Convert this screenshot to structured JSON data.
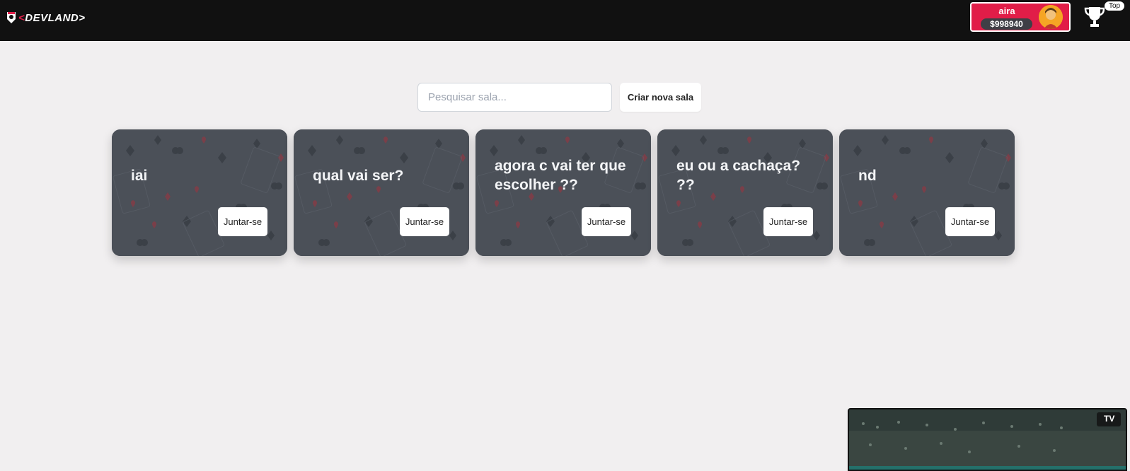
{
  "header": {
    "logo_mark": "<",
    "logo_text": "DEVLAND>",
    "user": {
      "name": "aira",
      "balance": "$998940"
    },
    "top_label": "Top"
  },
  "lobby": {
    "search": {
      "placeholder": "Pesquisar sala...",
      "value": ""
    },
    "create_label": "Criar nova sala",
    "rooms": [
      {
        "title": "iai",
        "join_label": "Juntar-se"
      },
      {
        "title": "qual vai ser?",
        "join_label": "Juntar-se"
      },
      {
        "title": "agora c vai ter que escolher ??",
        "join_label": "Juntar-se"
      },
      {
        "title": "eu ou a cachaça? ??",
        "join_label": "Juntar-se"
      },
      {
        "title": "nd",
        "join_label": "Juntar-se"
      }
    ]
  },
  "video": {
    "channel_logo": "TV"
  },
  "colors": {
    "topbar": "#111111",
    "accent": "#e11d48",
    "page_bg": "#f1eff0",
    "card_bg": "#4b5058"
  }
}
